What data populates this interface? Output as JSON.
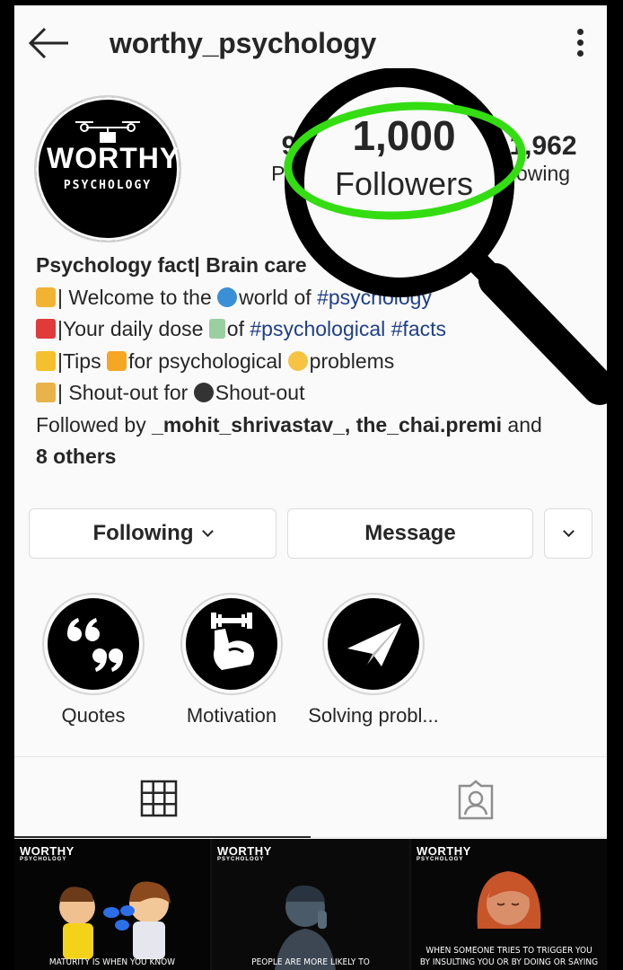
{
  "header": {
    "username": "worthy_psychology",
    "back_icon": "back-arrow-icon",
    "more_icon": "more-vertical-icon"
  },
  "avatar": {
    "logo_text": "WORTHY",
    "logo_subtext": "PSYCHOLOGY"
  },
  "stats": {
    "posts": {
      "count": "9",
      "label": "Pos"
    },
    "followers": {
      "count": "1,000",
      "label": "Followers"
    },
    "following": {
      "count": "1,962",
      "label": "owing"
    }
  },
  "bio": {
    "name": "Psychology fact| Brain care",
    "line1_pre": "| Welcome to the",
    "line1_mid": "world of",
    "line1_tag": "#psychology",
    "line2_pre": "|Your daily dose",
    "line2_mid": "of",
    "line2_tag1": "#psychological",
    "line2_tag2": "#facts",
    "line3_pre": "|Tips",
    "line3_mid": "for psychological",
    "line3_post": "problems",
    "line4_pre": "| Shout-out for",
    "line4_post": "Shout-out",
    "followed_by_prefix": "Followed by",
    "followed_user1": "_mohit_shrivastav_",
    "followed_sep": ",",
    "followed_user2": "the_chai.premi",
    "followed_and": "and",
    "followed_others": "8 others"
  },
  "actions": {
    "following_label": "Following",
    "message_label": "Message"
  },
  "highlights": [
    {
      "label": "Quotes",
      "icon": "quote-marks-icon"
    },
    {
      "label": "Motivation",
      "icon": "flexed-arm-dumbbell-icon"
    },
    {
      "label": "Solving probl...",
      "icon": "paper-plane-icon"
    }
  ],
  "tabs": {
    "grid_icon": "grid-icon",
    "tagged_icon": "tagged-person-icon"
  },
  "posts": [
    {
      "brand": "WORTHY",
      "brand_sub": "PSYCHOLOGY",
      "caption": "MATURITY IS WHEN YOU KNOW"
    },
    {
      "brand": "WORTHY",
      "brand_sub": "PSYCHOLOGY",
      "caption": "PEOPLE ARE MORE LIKELY TO"
    },
    {
      "brand": "WORTHY",
      "brand_sub": "PSYCHOLOGY",
      "caption_line1": "WHEN SOMEONE TRIES TO TRIGGER YOU",
      "caption_line2": "BY INSULTING YOU OR BY DOING OR SAYING"
    }
  ],
  "colors": {
    "highlight_ring": "#33dd11",
    "hashtag": "#1f3f8a",
    "background": "#fafafa"
  }
}
